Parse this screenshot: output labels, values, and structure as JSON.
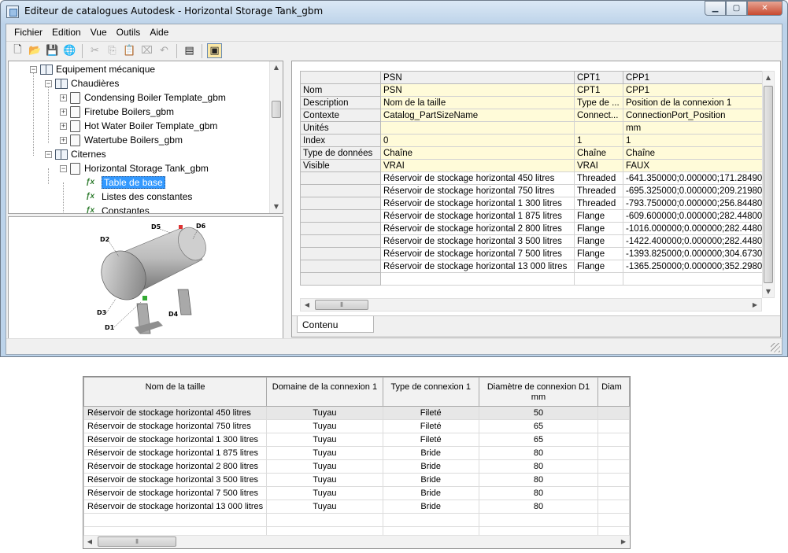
{
  "window": {
    "title": "Editeur de catalogues Autodesk - Horizontal Storage Tank_gbm",
    "controls": {
      "minimize": "▁",
      "maximize": "▢",
      "close": "✕"
    }
  },
  "menu": [
    "Fichier",
    "Edition",
    "Vue",
    "Outils",
    "Aide"
  ],
  "toolbar": [
    {
      "icon": "new-file-icon",
      "glyph": "🗋"
    },
    {
      "icon": "open-folder-icon",
      "glyph": "📂"
    },
    {
      "icon": "save-icon",
      "glyph": "💾"
    },
    {
      "icon": "publish-icon",
      "glyph": "🌐"
    },
    {
      "icon": "cut-icon",
      "glyph": "✂"
    },
    {
      "icon": "copy-icon",
      "glyph": "⎘"
    },
    {
      "icon": "paste-icon",
      "glyph": "📋"
    },
    {
      "icon": "delete-icon",
      "glyph": "⌧"
    },
    {
      "icon": "undo-icon",
      "glyph": "↶"
    },
    {
      "icon": "properties-icon",
      "glyph": "▤"
    },
    {
      "icon": "view-toggle-icon",
      "glyph": "▣"
    }
  ],
  "tree": [
    {
      "label": "Equipement mécanique",
      "type": "book"
    },
    {
      "label": "Chaudières",
      "type": "book"
    },
    {
      "label": "Condensing Boiler Template_gbm",
      "type": "page"
    },
    {
      "label": "Firetube Boilers_gbm",
      "type": "page"
    },
    {
      "label": "Hot Water Boiler Template_gbm",
      "type": "page"
    },
    {
      "label": "Watertube Boilers_gbm",
      "type": "page"
    },
    {
      "label": "Citernes",
      "type": "book"
    },
    {
      "label": "Horizontal Storage Tank_gbm",
      "type": "page"
    },
    {
      "label": "Table de base",
      "type": "fx"
    },
    {
      "label": "Listes des constantes",
      "type": "fx"
    },
    {
      "label": "Constantes",
      "type": "fx"
    }
  ],
  "preview": {
    "labels": [
      "D2",
      "D5",
      "D6",
      "D3",
      "D4",
      "D1"
    ]
  },
  "grid": {
    "columns": [
      "",
      "PSN",
      "CPT1",
      "CPP1"
    ],
    "meta_rows": [
      {
        "head": "Nom",
        "cells": [
          "PSN",
          "CPT1",
          "CPP1"
        ]
      },
      {
        "head": "Description",
        "cells": [
          "Nom de la taille",
          "Type de ...",
          "Position de la connexion 1"
        ]
      },
      {
        "head": "Contexte",
        "cells": [
          "Catalog_PartSizeName",
          "Connect...",
          "ConnectionPort_Position"
        ]
      },
      {
        "head": "Unités",
        "cells": [
          "",
          "",
          "mm"
        ]
      },
      {
        "head": "Index",
        "cells": [
          "0",
          "1",
          "1"
        ]
      },
      {
        "head": "Type de données",
        "cells": [
          "Chaîne",
          "Chaîne",
          "Chaîne"
        ]
      },
      {
        "head": "Visible",
        "cells": [
          "VRAI",
          "VRAI",
          "FAUX"
        ]
      }
    ],
    "data_rows": [
      [
        "Réservoir de stockage horizontal 450 litres",
        "Threaded",
        "-641.350000;0.000000;171.284900"
      ],
      [
        "Réservoir de stockage horizontal 750 litres",
        "Threaded",
        "-695.325000;0.000000;209.219800"
      ],
      [
        "Réservoir de stockage horizontal 1 300 litres",
        "Threaded",
        "-793.750000;0.000000;256.844800"
      ],
      [
        "Réservoir de stockage horizontal 1 875 litres",
        "Flange",
        "-609.600000;0.000000;282.448000"
      ],
      [
        "Réservoir de stockage horizontal 2 800 litres",
        "Flange",
        "-1016.000000;0.000000;282.44800"
      ],
      [
        "Réservoir de stockage horizontal 3 500 litres",
        "Flange",
        "-1422.400000;0.000000;282.44800"
      ],
      [
        "Réservoir de stockage horizontal 7 500 litres",
        "Flange",
        "-1393.825000;0.000000;304.67300"
      ],
      [
        "Réservoir de stockage horizontal 13 000 litres",
        "Flange",
        "-1365.250000;0.000000;352.29800"
      ],
      [
        "",
        "",
        ""
      ]
    ],
    "hscroll_grip": "⦀"
  },
  "tabs": [
    "Contenu"
  ],
  "lower_table": {
    "headers": [
      "Nom de la taille",
      "Domaine de la connexion 1",
      "Type de connexion 1",
      "Diamètre de connexion D1 mm",
      "Diam"
    ],
    "rows": [
      [
        "Réservoir de stockage horizontal 450 litres",
        "Tuyau",
        "Fileté",
        "50"
      ],
      [
        "Réservoir de stockage horizontal 750 litres",
        "Tuyau",
        "Fileté",
        "65"
      ],
      [
        "Réservoir de stockage horizontal 1 300 litres",
        "Tuyau",
        "Fileté",
        "65"
      ],
      [
        "Réservoir de stockage horizontal 1 875 litres",
        "Tuyau",
        "Bride",
        "80"
      ],
      [
        "Réservoir de stockage horizontal 2 800 litres",
        "Tuyau",
        "Bride",
        "80"
      ],
      [
        "Réservoir de stockage horizontal 3 500 litres",
        "Tuyau",
        "Bride",
        "80"
      ],
      [
        "Réservoir de stockage horizontal 7 500 litres",
        "Tuyau",
        "Bride",
        "80"
      ],
      [
        "Réservoir de stockage horizontal 13 000 litres",
        "Tuyau",
        "Bride",
        "80"
      ],
      [
        "",
        "",
        "",
        ""
      ],
      [
        "",
        "",
        "",
        ""
      ]
    ]
  }
}
